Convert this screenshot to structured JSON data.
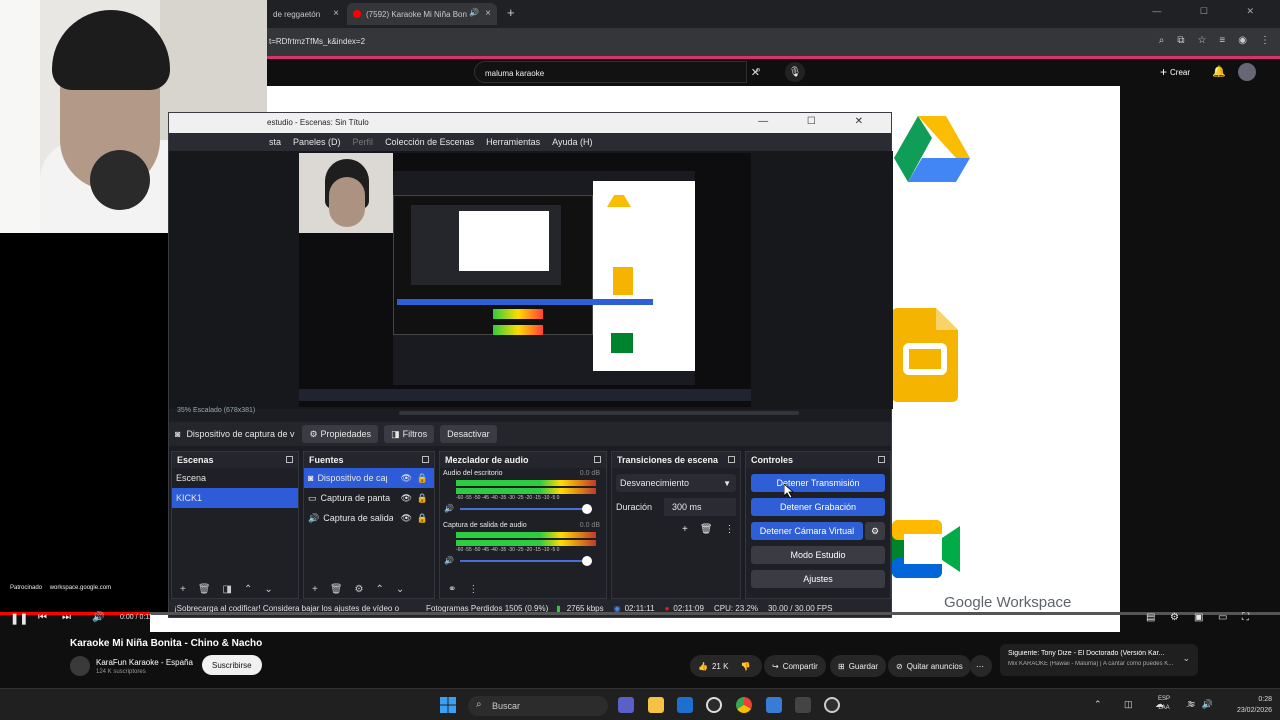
{
  "browser": {
    "tabs": [
      {
        "label": "de reggaetón"
      },
      {
        "label": "(7592) Karaoke Mi Niña Bon"
      }
    ],
    "url": "t=RDfrtmzTfMs_k&index=2"
  },
  "youtube": {
    "search_value": "maluma karaoke",
    "create_label": "Crear",
    "video_title": "Karaoke Mi Niña Bonita - Chino & Nacho",
    "channel_name": "KaraFun Karaoke - España",
    "subscribers": "124 K suscriptores",
    "subscribe_label": "Suscribirse",
    "likes": "21 K",
    "share_label": "Compartir",
    "save_label": "Guardar",
    "remove_ads_label": "Quitar anuncios",
    "time": "0:00 / 0:11",
    "next_up_title": "Siguiente: Tony Dize - El Doctorado (Versión Kar...",
    "next_up_sub": "Mix KARAOKE (Hawaii - Maluma) | A cantar como puedes K...",
    "sponsored": "Patrocinado",
    "sponsor_url": "workspace.google.com",
    "workspace_label": "Google Workspace"
  },
  "obs": {
    "title": "estudio - Escenas: Sin Título",
    "menu": [
      "sta",
      "Paneles (D)",
      "Perfil",
      "Colección de Escenas",
      "Herramientas",
      "Ayuda (H)"
    ],
    "scale_text": "35%    Escalado (678x381)",
    "source_selected": "Dispositivo de captura de v",
    "properties_label": "Propiedades",
    "filters_label": "Filtros",
    "deactivate_label": "Desactivar",
    "docks": {
      "scenes": {
        "title": "Escenas",
        "items": [
          "Escena",
          "KICK1"
        ]
      },
      "sources": {
        "title": "Fuentes",
        "items": [
          "Dispositivo de cap",
          "Captura de panta",
          "Captura de salida"
        ]
      },
      "mixer": {
        "title": "Mezclador de audio",
        "channels": [
          {
            "name": "Audio del escritorio",
            "db": "0.0 dB"
          },
          {
            "name": "Captura de salida de audio",
            "db": "0.0 dB"
          }
        ],
        "scale": "-60 -55 -50 -45 -40 -35 -30 -25 -20 -15 -10 -5 0"
      },
      "transitions": {
        "title": "Transiciones de escena",
        "selected": "Desvanecimiento",
        "duration_label": "Duración",
        "duration_value": "300 ms"
      },
      "controls": {
        "title": "Controles",
        "buttons": [
          "Detener Transmisión",
          "Detener Grabación",
          "Detener Cámara Virtual",
          "Modo Estudio",
          "Ajustes"
        ]
      }
    },
    "status": {
      "warning": "¡Sobrecarga al codificar! Considera bajar los ajustes de vídeo o",
      "dropped": "Fotogramas Perdidos 1505 (0.9%)",
      "kbps": "2765 kbps",
      "stream_time": "02:11:11",
      "rec_time": "02:11:09",
      "cpu": "CPU: 23.2%",
      "fps": "30.00 / 30.00 FPS"
    }
  },
  "taskbar": {
    "search_placeholder": "Buscar",
    "lang_top": "ESP",
    "lang_bottom": "LAA",
    "time": "0:28",
    "date": "23/02/2026"
  },
  "colors": {
    "accent_blue": "#2f5fd6",
    "yt_red": "#ff0000",
    "obs_bg": "#1c1d22"
  }
}
